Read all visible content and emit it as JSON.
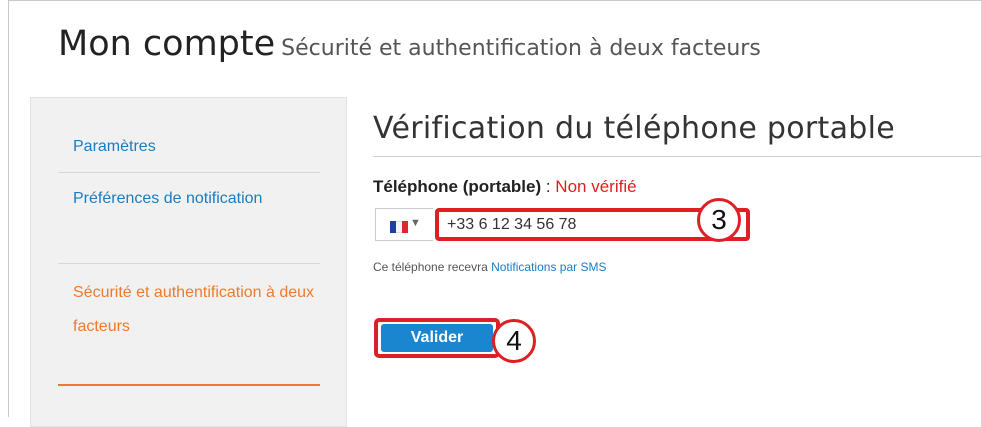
{
  "header": {
    "title": "Mon compte",
    "subtitle": "Sécurité et authentification à deux facteurs"
  },
  "sidebar": {
    "items": [
      {
        "label": "Paramètres",
        "active": false
      },
      {
        "label": "Préférences de notification",
        "active": false
      },
      {
        "label": "Sécurité et authentification à deux facteurs",
        "active": true
      }
    ]
  },
  "main": {
    "section_title": "Vérification du téléphone portable",
    "phone": {
      "label": "Téléphone (portable)",
      "separator": " : ",
      "status": "Non vérifié",
      "value": "+33 6 12 34 56 78",
      "country_flag": "france-flag-icon"
    },
    "helper": {
      "text": "Ce téléphone recevra ",
      "link": "Notifications par SMS"
    },
    "submit_label": "Valider"
  },
  "annotations": {
    "marker_phone": "3",
    "marker_submit": "4"
  },
  "colors": {
    "link_blue": "#1a7cc1",
    "active_orange": "#f07a2a",
    "status_red": "#e02020",
    "annotation_red": "#dd1f26",
    "button_blue": "#1a86d0"
  }
}
